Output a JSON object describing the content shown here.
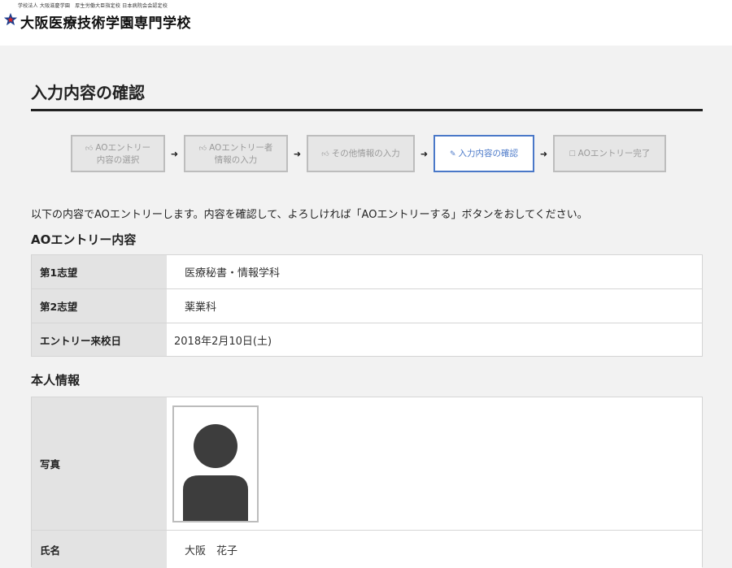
{
  "header": {
    "org_line": "学校法人 大阪滋慶学園　厚生労働大臣指定校 日本病院会会認定校",
    "school_name": "大阪医療技術学園専門学校",
    "logo_icon": "star-logo-icon"
  },
  "page": {
    "title": "入力内容の確認",
    "intro": "以下の内容でAOエントリーします。内容を確認して、よろしければ「AOエントリーする」ボタンをおしてください。"
  },
  "steps": [
    {
      "icon": "thumbs-up-icon",
      "line1": "AOエントリー",
      "line2": "内容の選択",
      "active": false
    },
    {
      "icon": "thumbs-up-icon",
      "line1": "AOエントリー者",
      "line2": "情報の入力",
      "active": false
    },
    {
      "icon": "thumbs-up-icon",
      "line1": "その他情報の入力",
      "line2": "",
      "active": false
    },
    {
      "icon": "edit-icon",
      "line1": "入力内容の確認",
      "line2": "",
      "active": true
    },
    {
      "icon": "checkbox-icon",
      "line1": "AOエントリー完了",
      "line2": "",
      "active": false
    }
  ],
  "entry_section": {
    "title": "AOエントリー内容",
    "rows": [
      {
        "label": "第1志望",
        "value": "医療秘書・情報学科"
      },
      {
        "label": "第2志望",
        "value": "薬業科"
      },
      {
        "label": "エントリー来校日",
        "value": "2018年2月10日(土)"
      }
    ]
  },
  "personal_section": {
    "title": "本人情報",
    "photo_label": "写真",
    "photo_icon": "person-silhouette-icon",
    "name_label": "氏名",
    "name_value": "大阪　花子"
  },
  "colors": {
    "active_step": "#4a78c8",
    "label_bg": "#e3e3e3",
    "page_bg": "#f2f2f2"
  }
}
